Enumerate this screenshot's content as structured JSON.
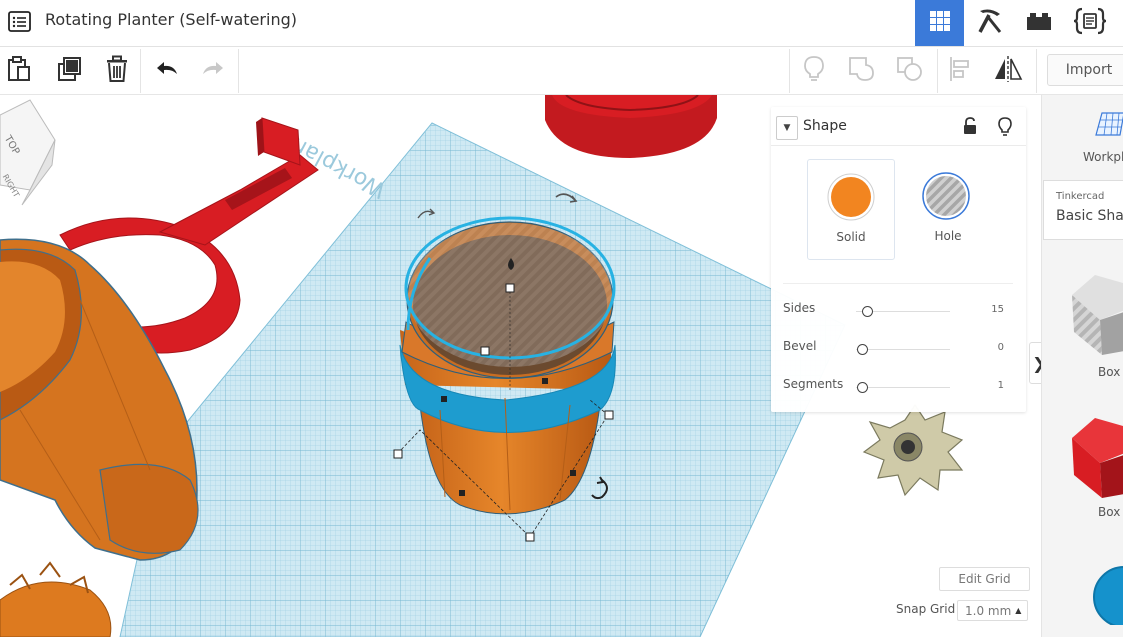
{
  "header": {
    "title": "Rotating Planter (Self-watering)",
    "menu_icon": "list-icon",
    "view_buttons": [
      {
        "icon": "grid-view-icon",
        "active": true
      },
      {
        "icon": "pickaxe-icon",
        "active": false
      },
      {
        "icon": "bricks-icon",
        "active": false
      },
      {
        "icon": "code-blocks-icon",
        "active": false
      }
    ]
  },
  "toolbar": {
    "left_icons": [
      "clipboard-icon",
      "duplicate-icon",
      "trash-icon",
      "undo-icon",
      "redo-icon"
    ],
    "right_icons": [
      "lightbulb-icon",
      "group-icon",
      "ungroup-icon",
      "align-icon",
      "mirror-icon"
    ],
    "import_label": "Import"
  },
  "viewport": {
    "viewcube_top": "TOP",
    "viewcube_side": "RIGHT",
    "workplane_label": "Workplane"
  },
  "inspector": {
    "title": "Shape",
    "modes": [
      {
        "label": "Solid",
        "color": "#f28520"
      },
      {
        "label": "Hole",
        "color": "#a7a7a7"
      }
    ],
    "params": [
      {
        "label": "Sides",
        "value": "15",
        "level": 0.0
      },
      {
        "label": "Bevel",
        "value": "0",
        "level": 0.0
      },
      {
        "label": "Segments",
        "value": "1",
        "level": 0.0
      }
    ]
  },
  "right_panel": {
    "workplane_label": "Workplane",
    "library_source": "Tinkercad",
    "library_name": "Basic Shapes",
    "shapes": [
      {
        "label": "Box",
        "color": "#b8b8b8"
      },
      {
        "label": "Box",
        "color": "#d81d23"
      }
    ]
  },
  "grid_controls": {
    "edit_grid_label": "Edit Grid",
    "snap_grid_label": "Snap Grid",
    "snap_value": "1.0 mm"
  },
  "colors": {
    "accent": "#3b7ad9",
    "planter_orange": "#dd7a1f",
    "selection_blue": "#1fa8d8",
    "red_parts": "#d81d23",
    "workplane": "#c7e6f2"
  }
}
